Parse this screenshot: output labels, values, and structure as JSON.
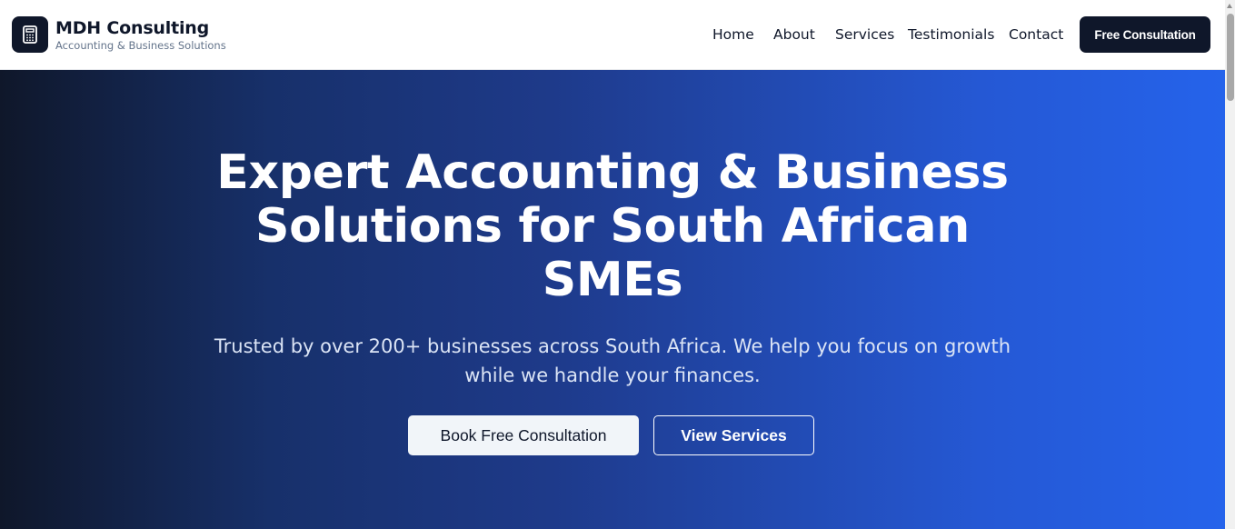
{
  "header": {
    "brand_name": "MDH Consulting",
    "brand_tagline": "Accounting & Business Solutions",
    "logo_icon": "calculator-icon",
    "nav": [
      {
        "label": "Home"
      },
      {
        "label": "About"
      },
      {
        "label": "Services"
      },
      {
        "label": "Testimonials"
      },
      {
        "label": "Contact"
      }
    ],
    "cta_label": "Free Consultation"
  },
  "hero": {
    "title_line1": "Expert Accounting & Business",
    "title_line2": "Solutions for South African",
    "title_line3": "SMEs",
    "subtitle_line1": "Trusted by over 200+ businesses across South Africa. We help you focus on growth",
    "subtitle_line2": "while we handle your finances.",
    "primary_button": "Book Free Consultation",
    "secondary_button": "View Services"
  },
  "colors": {
    "brand_dark": "#0f172a",
    "accent_blue": "#2563eb",
    "hero_gradient_start": "#0f172a",
    "hero_gradient_end": "#2563eb"
  }
}
